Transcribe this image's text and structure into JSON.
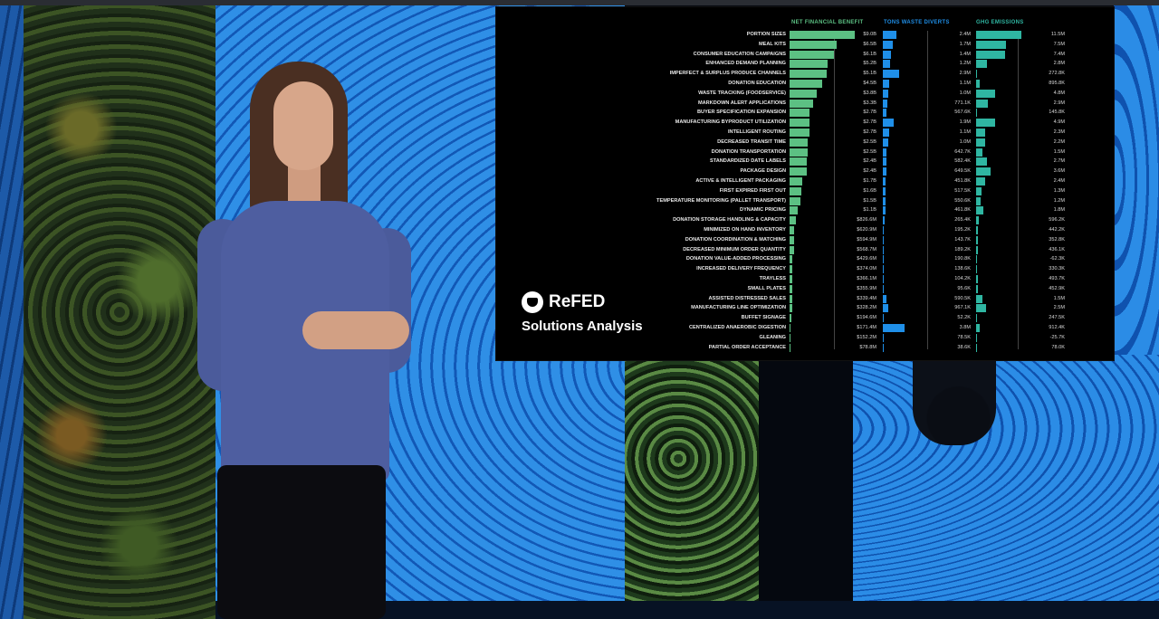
{
  "screen": {
    "brand_name": "ReFED",
    "subtitle": "Solutions Analysis",
    "columns": [
      "NET FINANCIAL BENEFIT",
      "TONS WASTE DIVERTS",
      "GHG EMISSIONS"
    ],
    "colors": {
      "green": "#5cc083",
      "blue": "#1f8fe8",
      "teal": "#2fb6a2"
    }
  },
  "chart_data": {
    "type": "table",
    "title": "",
    "rows": [
      {
        "label": "PORTION SIZES",
        "benefit": "$9.0B",
        "waste": "2.4M",
        "ghg": "11.5M",
        "b": 9.0,
        "w": 2.4,
        "g": 11.5
      },
      {
        "label": "MEAL KITS",
        "benefit": "$6.5B",
        "waste": "1.7M",
        "ghg": "7.5M",
        "b": 6.5,
        "w": 1.7,
        "g": 7.5
      },
      {
        "label": "CONSUMER EDUCATION CAMPAIGNS",
        "benefit": "$6.1B",
        "waste": "1.4M",
        "ghg": "7.4M",
        "b": 6.1,
        "w": 1.4,
        "g": 7.4
      },
      {
        "label": "ENHANCED DEMAND PLANNING",
        "benefit": "$5.2B",
        "waste": "1.2M",
        "ghg": "2.8M",
        "b": 5.2,
        "w": 1.2,
        "g": 2.8
      },
      {
        "label": "IMPERFECT & SURPLUS PRODUCE CHANNELS",
        "benefit": "$5.1B",
        "waste": "2.9M",
        "ghg": "272.8K",
        "b": 5.1,
        "w": 2.9,
        "g": 0.27
      },
      {
        "label": "DONATION EDUCATION",
        "benefit": "$4.5B",
        "waste": "1.1M",
        "ghg": "895.8K",
        "b": 4.5,
        "w": 1.1,
        "g": 0.9
      },
      {
        "label": "WASTE TRACKING (FOODSERVICE)",
        "benefit": "$3.8B",
        "waste": "1.0M",
        "ghg": "4.8M",
        "b": 3.8,
        "w": 1.0,
        "g": 4.8
      },
      {
        "label": "MARKDOWN ALERT APPLICATIONS",
        "benefit": "$3.3B",
        "waste": "771.1K",
        "ghg": "2.9M",
        "b": 3.3,
        "w": 0.77,
        "g": 2.9
      },
      {
        "label": "BUYER SPECIFICATION EXPANSION",
        "benefit": "$2.7B",
        "waste": "567.6K",
        "ghg": "145.8K",
        "b": 2.7,
        "w": 0.57,
        "g": 0.15
      },
      {
        "label": "MANUFACTURING BYPRODUCT UTILIZATION",
        "benefit": "$2.7B",
        "waste": "1.9M",
        "ghg": "4.9M",
        "b": 2.7,
        "w": 1.9,
        "g": 4.9
      },
      {
        "label": "INTELLIGENT ROUTING",
        "benefit": "$2.7B",
        "waste": "1.1M",
        "ghg": "2.3M",
        "b": 2.7,
        "w": 1.1,
        "g": 2.3
      },
      {
        "label": "DECREASED TRANSIT TIME",
        "benefit": "$2.5B",
        "waste": "1.0M",
        "ghg": "2.2M",
        "b": 2.5,
        "w": 1.0,
        "g": 2.2
      },
      {
        "label": "DONATION TRANSPORTATION",
        "benefit": "$2.5B",
        "waste": "642.7K",
        "ghg": "1.5M",
        "b": 2.5,
        "w": 0.64,
        "g": 1.5
      },
      {
        "label": "STANDARDIZED DATE LABELS",
        "benefit": "$2.4B",
        "waste": "582.4K",
        "ghg": "2.7M",
        "b": 2.4,
        "w": 0.58,
        "g": 2.7
      },
      {
        "label": "PACKAGE DESIGN",
        "benefit": "$2.4B",
        "waste": "649.5K",
        "ghg": "3.6M",
        "b": 2.4,
        "w": 0.65,
        "g": 3.6
      },
      {
        "label": "ACTIVE & INTELLIGENT PACKAGING",
        "benefit": "$1.7B",
        "waste": "451.8K",
        "ghg": "2.4M",
        "b": 1.7,
        "w": 0.45,
        "g": 2.4
      },
      {
        "label": "FIRST EXPIRED FIRST OUT",
        "benefit": "$1.6B",
        "waste": "517.5K",
        "ghg": "1.3M",
        "b": 1.6,
        "w": 0.52,
        "g": 1.3
      },
      {
        "label": "TEMPERATURE MONITORING (PALLET TRANSPORT)",
        "benefit": "$1.5B",
        "waste": "550.6K",
        "ghg": "1.2M",
        "b": 1.5,
        "w": 0.55,
        "g": 1.2
      },
      {
        "label": "DYNAMIC PRICING",
        "benefit": "$1.1B",
        "waste": "461.8K",
        "ghg": "1.8M",
        "b": 1.1,
        "w": 0.46,
        "g": 1.8
      },
      {
        "label": "DONATION STORAGE HANDLING & CAPACITY",
        "benefit": "$826.6M",
        "waste": "265.4K",
        "ghg": "596.2K",
        "b": 0.83,
        "w": 0.27,
        "g": 0.6
      },
      {
        "label": "MINIMIZED ON HAND INVENTORY",
        "benefit": "$620.9M",
        "waste": "195.2K",
        "ghg": "442.2K",
        "b": 0.62,
        "w": 0.2,
        "g": 0.44
      },
      {
        "label": "DONATION COORDINATION & MATCHING",
        "benefit": "$594.9M",
        "waste": "143.7K",
        "ghg": "352.8K",
        "b": 0.59,
        "w": 0.14,
        "g": 0.35
      },
      {
        "label": "DECREASED MINIMUM ORDER QUANTITY",
        "benefit": "$568.7M",
        "waste": "189.2K",
        "ghg": "436.1K",
        "b": 0.57,
        "w": 0.19,
        "g": 0.44
      },
      {
        "label": "DONATION VALUE-ADDED PROCESSING",
        "benefit": "$429.6M",
        "waste": "190.8K",
        "ghg": "-62.3K",
        "b": 0.43,
        "w": 0.19,
        "g": -0.06
      },
      {
        "label": "INCREASED DELIVERY FREQUENCY",
        "benefit": "$374.0M",
        "waste": "138.6K",
        "ghg": "330.3K",
        "b": 0.37,
        "w": 0.14,
        "g": 0.33
      },
      {
        "label": "TRAYLESS",
        "benefit": "$366.1M",
        "waste": "104.2K",
        "ghg": "493.7K",
        "b": 0.37,
        "w": 0.1,
        "g": 0.49
      },
      {
        "label": "SMALL PLATES",
        "benefit": "$355.9M",
        "waste": "95.6K",
        "ghg": "452.9K",
        "b": 0.36,
        "w": 0.1,
        "g": 0.45
      },
      {
        "label": "ASSISTED DISTRESSED SALES",
        "benefit": "$339.4M",
        "waste": "590.5K",
        "ghg": "1.5M",
        "b": 0.34,
        "w": 0.59,
        "g": 1.5
      },
      {
        "label": "MANUFACTURING LINE OPTIMIZATION",
        "benefit": "$328.2M",
        "waste": "967.1K",
        "ghg": "2.5M",
        "b": 0.33,
        "w": 0.97,
        "g": 2.5
      },
      {
        "label": "BUFFET SIGNAGE",
        "benefit": "$194.6M",
        "waste": "52.2K",
        "ghg": "247.5K",
        "b": 0.19,
        "w": 0.05,
        "g": 0.25
      },
      {
        "label": "CENTRALIZED ANAEROBIC DIGESTION",
        "benefit": "$171.4M",
        "waste": "3.8M",
        "ghg": "912.4K",
        "b": 0.17,
        "w": 3.8,
        "g": 0.91
      },
      {
        "label": "GLEANING",
        "benefit": "$152.2M",
        "waste": "78.5K",
        "ghg": "-25.7K",
        "b": 0.15,
        "w": 0.08,
        "g": -0.03
      },
      {
        "label": "PARTIAL ORDER ACCEPTANCE",
        "benefit": "$78.8M",
        "waste": "38.6K",
        "ghg": "78.0K",
        "b": 0.08,
        "w": 0.04,
        "g": 0.08
      }
    ]
  }
}
